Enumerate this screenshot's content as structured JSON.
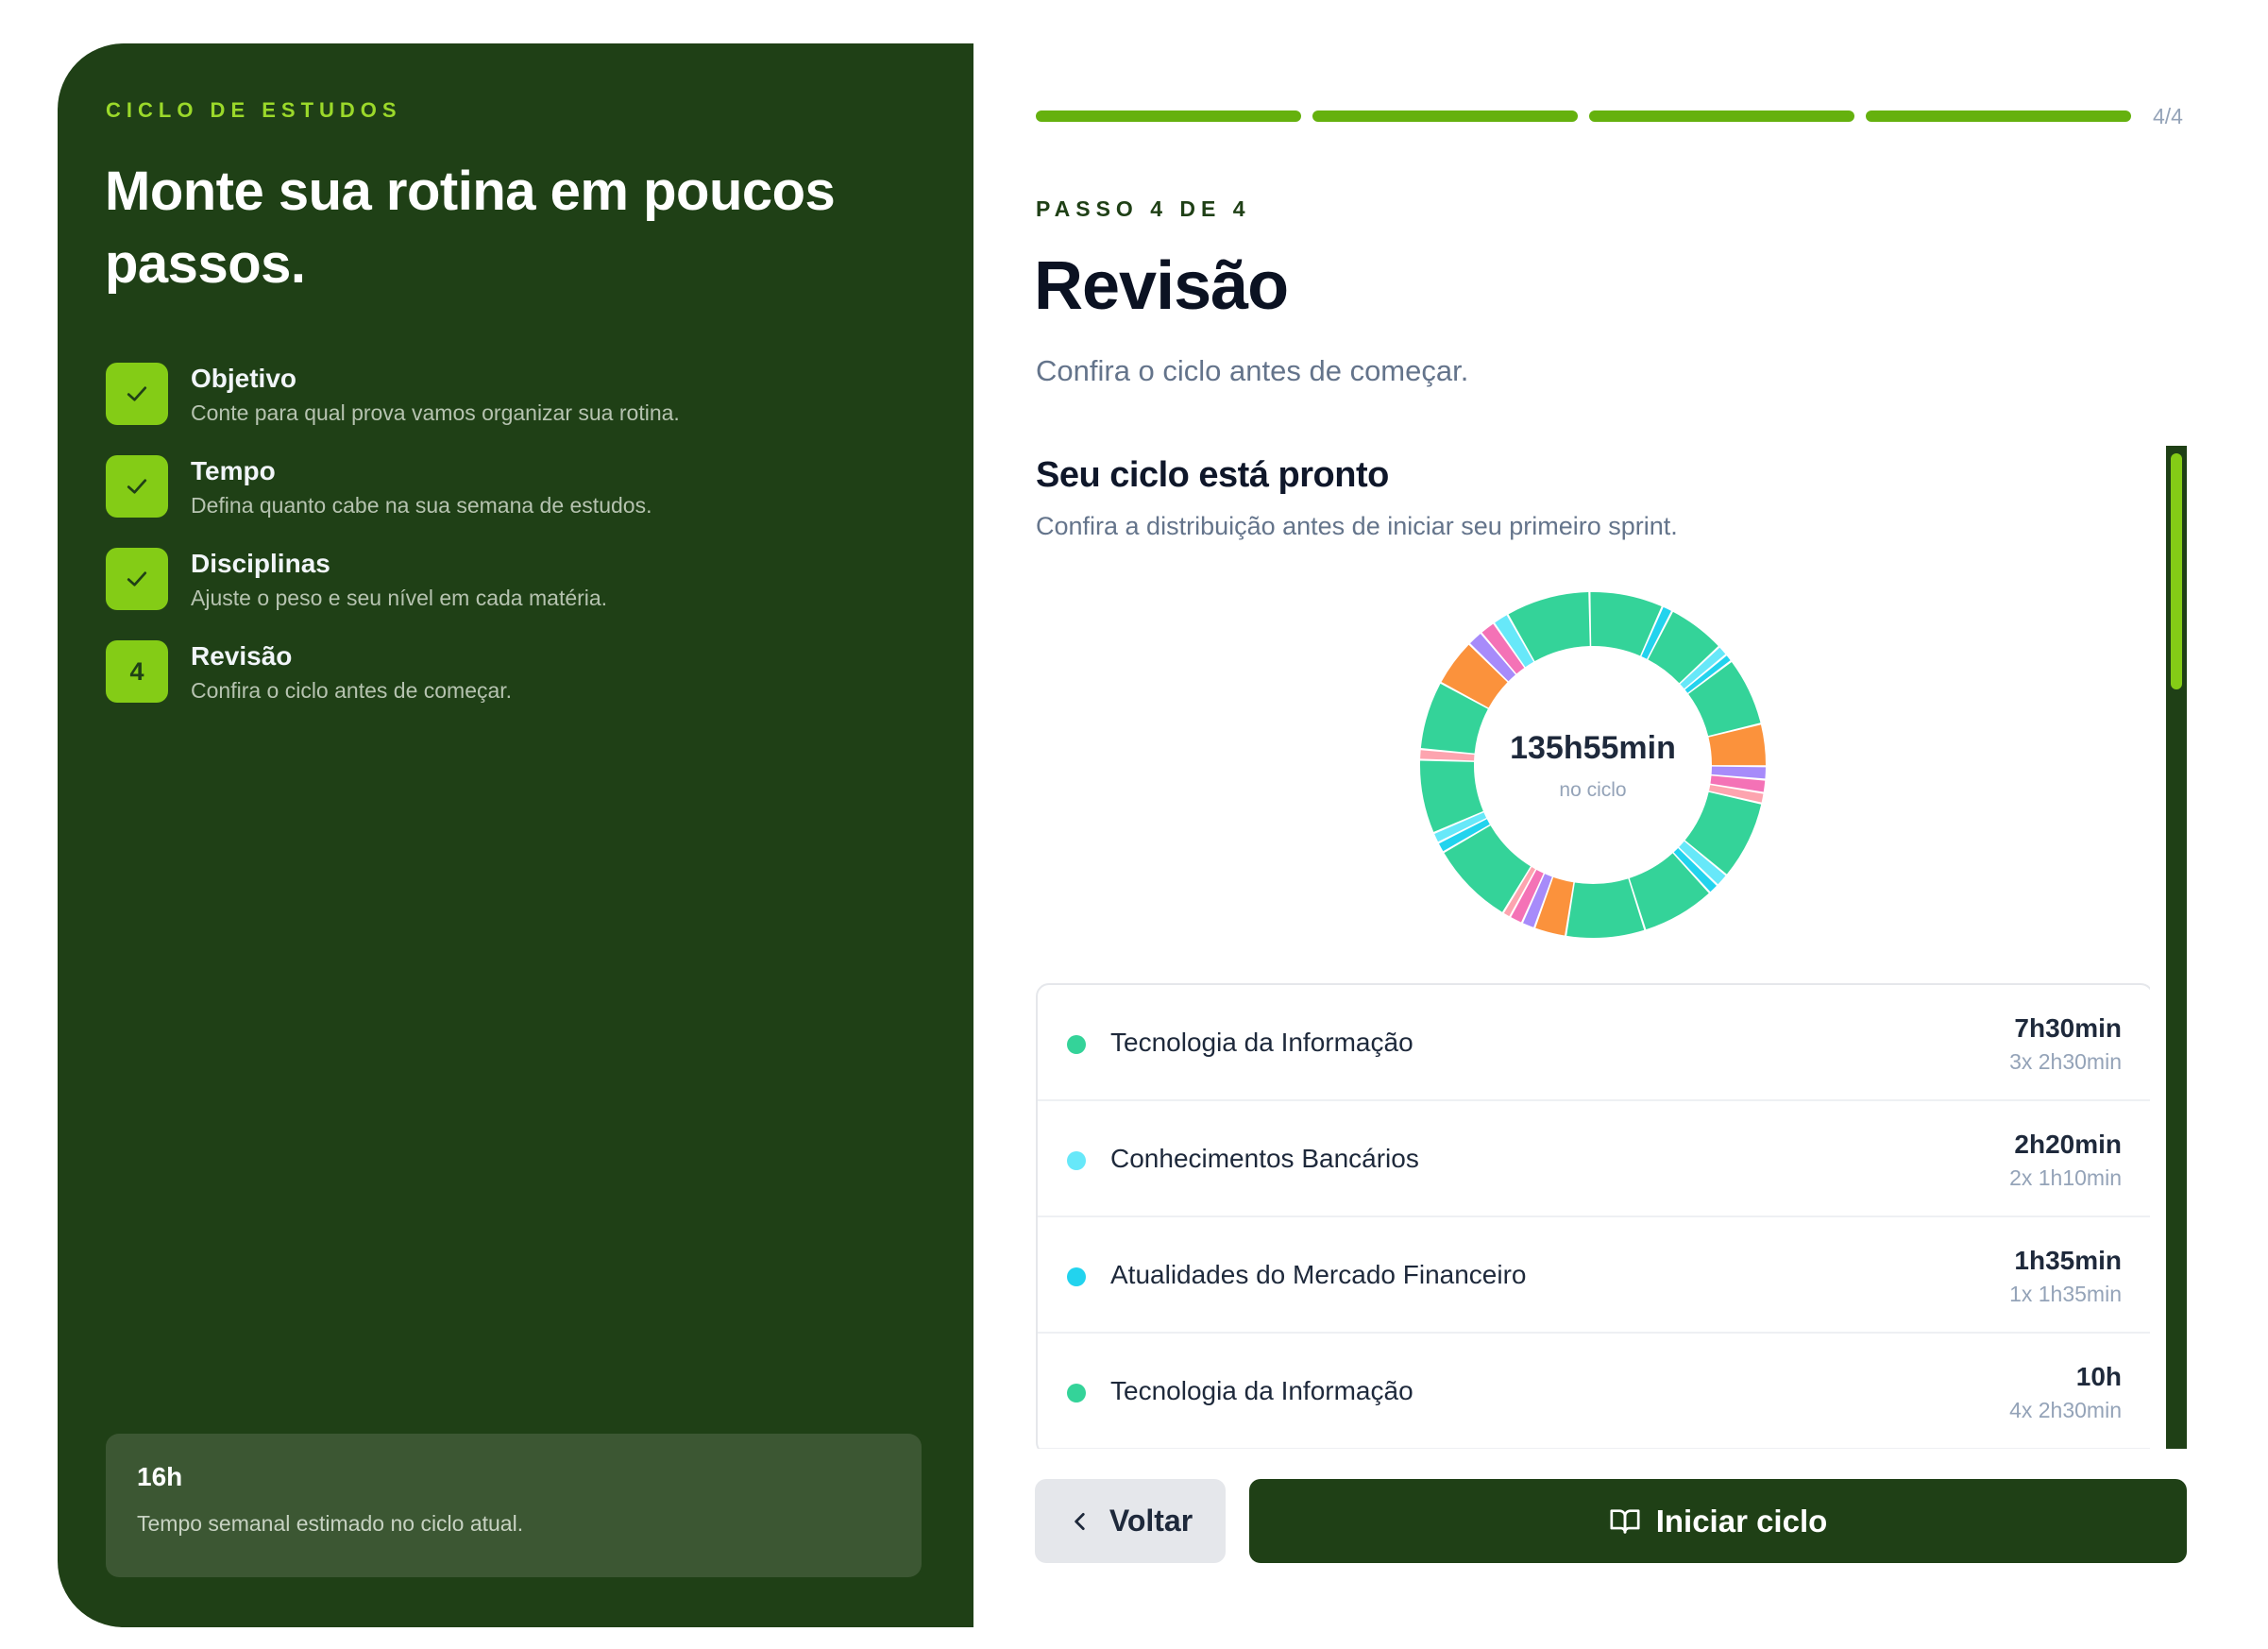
{
  "sidebar": {
    "eyebrow": "CICLO DE ESTUDOS",
    "title": "Monte sua rotina em poucos passos.",
    "steps": [
      {
        "badge": "✓",
        "name": "Objetivo",
        "desc": "Conte para qual prova vamos organizar sua rotina.",
        "done": true
      },
      {
        "badge": "✓",
        "name": "Tempo",
        "desc": "Defina quanto cabe na sua semana de estudos.",
        "done": true
      },
      {
        "badge": "✓",
        "name": "Disciplinas",
        "desc": "Ajuste o peso e seu nível em cada matéria.",
        "done": true
      },
      {
        "badge": "4",
        "name": "Revisão",
        "desc": "Confira o ciclo antes de começar.",
        "done": false
      }
    ],
    "summary": {
      "hours": "16h",
      "text": "Tempo semanal estimado no ciclo atual."
    }
  },
  "progress": {
    "count": "4/4",
    "completed": 4,
    "total": 4
  },
  "main": {
    "step_label": "PASSO 4 DE 4",
    "title": "Revisão",
    "subtitle": "Confira o ciclo antes de começar.",
    "card_title": "Seu ciclo está pronto",
    "card_subtitle": "Confira a distribuição antes de iniciar seu primeiro sprint.",
    "donut_total": "135h55min",
    "donut_caption": "no ciclo",
    "subjects": [
      {
        "name": "Tecnologia da Informação",
        "total": "7h30min",
        "split": "3x 2h30min",
        "color": "#34d399"
      },
      {
        "name": "Conhecimentos Bancários",
        "total": "2h20min",
        "split": "2x 1h10min",
        "color": "#67e8f9"
      },
      {
        "name": "Atualidades do Mercado Financeiro",
        "total": "1h35min",
        "split": "1x 1h35min",
        "color": "#22d3ee"
      },
      {
        "name": "Tecnologia da Informação",
        "total": "10h",
        "split": "4x 2h30min",
        "color": "#34d399"
      }
    ]
  },
  "buttons": {
    "back": "Voltar",
    "start": "Iniciar ciclo"
  },
  "colors": {
    "brand_dark": "#1f4016",
    "accent_green": "#84cc16",
    "progress_green": "#65b10e",
    "teal": "#34d399",
    "cyan_light": "#67e8f9",
    "cyan": "#22d3ee",
    "orange": "#fb923c",
    "purple": "#a78bfa",
    "pink": "#f472b6",
    "rose_light": "#fda4af"
  }
}
